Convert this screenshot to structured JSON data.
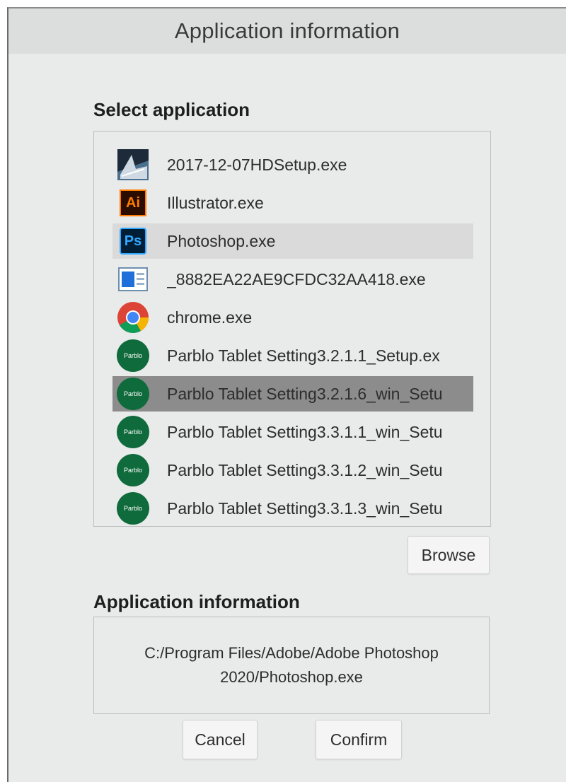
{
  "dialog": {
    "title": "Application information"
  },
  "select_section": {
    "label": "Select application",
    "items": [
      {
        "label": "2017-12-07HDSetup.exe",
        "icon": "installer-icon"
      },
      {
        "label": "Illustrator.exe",
        "icon": "illustrator-icon",
        "icon_text": "Ai"
      },
      {
        "label": "Photoshop.exe",
        "icon": "photoshop-icon",
        "icon_text": "Ps",
        "state": "selected"
      },
      {
        "label": "_8882EA22AE9CFDC32AA418.exe",
        "icon": "window-app-icon"
      },
      {
        "label": "chrome.exe",
        "icon": "chrome-icon"
      },
      {
        "label": "Parblo Tablet Setting3.2.1.1_Setup.ex",
        "icon": "parblo-icon",
        "icon_text": "Parblo"
      },
      {
        "label": "Parblo Tablet Setting3.2.1.6_win_Setu",
        "icon": "parblo-icon",
        "icon_text": "Parblo",
        "state": "hovered"
      },
      {
        "label": "Parblo Tablet Setting3.3.1.1_win_Setu",
        "icon": "parblo-icon",
        "icon_text": "Parblo"
      },
      {
        "label": "Parblo Tablet Setting3.3.1.2_win_Setu",
        "icon": "parblo-icon",
        "icon_text": "Parblo"
      },
      {
        "label": "Parblo Tablet Setting3.3.1.3_win_Setu",
        "icon": "parblo-icon",
        "icon_text": "Parblo"
      }
    ],
    "browse_label": "Browse"
  },
  "info_section": {
    "label": "Application information",
    "path": "C:/Program Files/Adobe/Adobe Photoshop 2020/Photoshop.exe"
  },
  "footer": {
    "cancel_label": "Cancel",
    "confirm_label": "Confirm"
  },
  "colors": {
    "dialog_bg": "#e9eaea",
    "titlebar_bg": "#dcdddd",
    "selected_light": "#dadada",
    "selected_dark": "#8c8c8c",
    "parblo_green": "#0f6b3c"
  }
}
